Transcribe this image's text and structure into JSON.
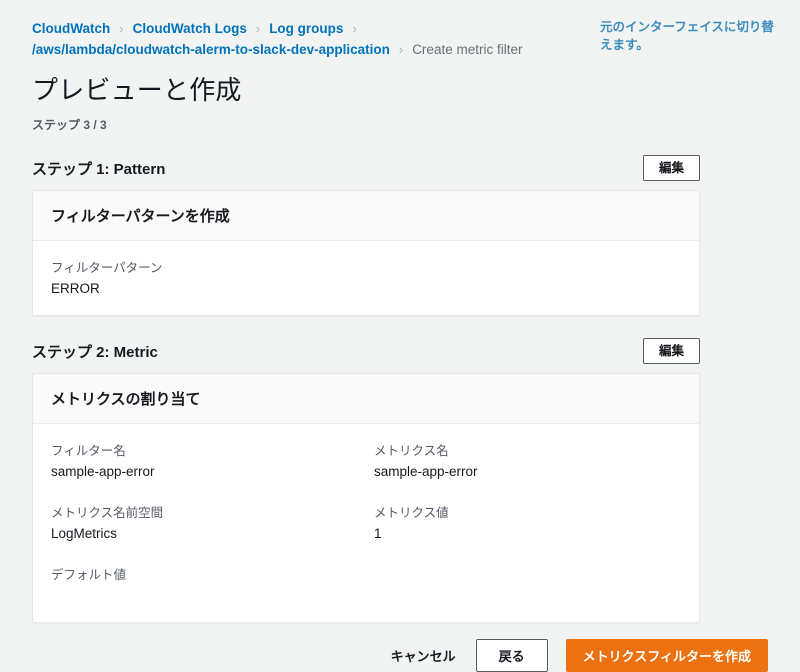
{
  "breadcrumb": {
    "items": [
      {
        "label": "CloudWatch",
        "current": false
      },
      {
        "label": "CloudWatch Logs",
        "current": false
      },
      {
        "label": "Log groups",
        "current": false
      },
      {
        "label": "/aws/lambda/cloudwatch-alerm-to-slack-dev-application",
        "current": false
      },
      {
        "label": "Create metric filter",
        "current": true
      }
    ],
    "separator": "›"
  },
  "switch_link": {
    "label": "元のインターフェイスに切り替えます。",
    "color": "#3b8dbd"
  },
  "page": {
    "title": "プレビューと作成",
    "step_indicator": "ステップ 3 / 3"
  },
  "sections": [
    {
      "title": "ステップ 1: Pattern",
      "edit_label": "編集",
      "card_title": "フィルターパターンを作成",
      "fields": [
        {
          "label": "フィルターパターン",
          "value": "ERROR"
        }
      ]
    },
    {
      "title": "ステップ 2: Metric",
      "edit_label": "編集",
      "card_title": "メトリクスの割り当て",
      "fields": [
        {
          "label": "フィルター名",
          "value": "sample-app-error"
        },
        {
          "label": "メトリクス名",
          "value": "sample-app-error"
        },
        {
          "label": "メトリクス名前空間",
          "value": "LogMetrics"
        },
        {
          "label": "メトリクス値",
          "value": "1"
        },
        {
          "label": "デフォルト値",
          "value": ""
        }
      ]
    }
  ],
  "footer": {
    "cancel_label": "キャンセル",
    "back_label": "戻る",
    "submit_label": "メトリクスフィルターを作成",
    "submit_color": "#ec7211"
  }
}
